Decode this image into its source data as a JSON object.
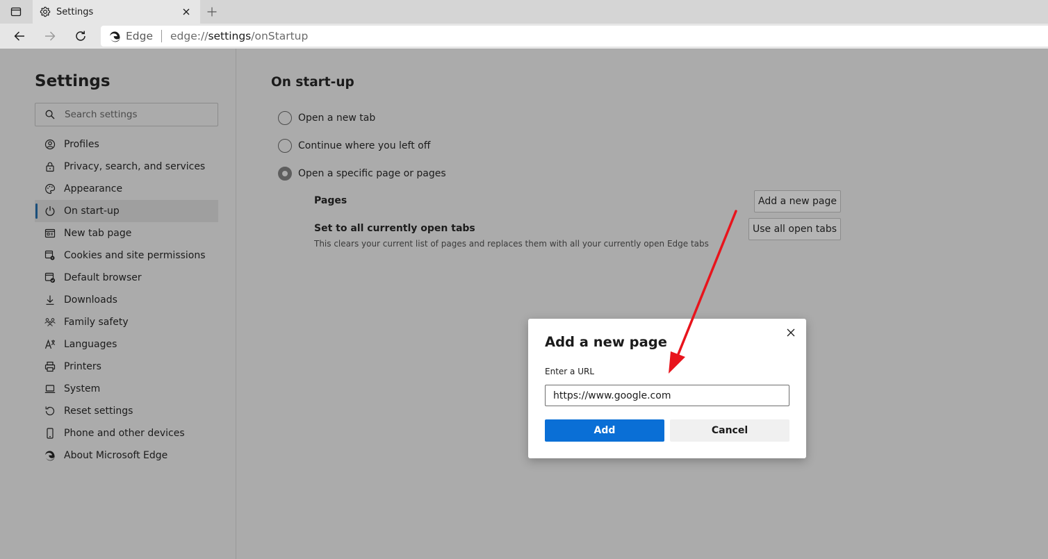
{
  "browser": {
    "tab": {
      "title": "Settings"
    },
    "address": {
      "brand": "Edge",
      "url_prefix": "edge://",
      "url_host": "settings",
      "url_path": "/onStartup"
    }
  },
  "sidebar": {
    "title": "Settings",
    "search_placeholder": "Search settings",
    "items": [
      {
        "label": "Profiles",
        "icon": "profile-icon"
      },
      {
        "label": "Privacy, search, and services",
        "icon": "lock-icon"
      },
      {
        "label": "Appearance",
        "icon": "palette-icon"
      },
      {
        "label": "On start-up",
        "icon": "power-icon",
        "active": true
      },
      {
        "label": "New tab page",
        "icon": "new-tab-icon"
      },
      {
        "label": "Cookies and site permissions",
        "icon": "cookies-icon"
      },
      {
        "label": "Default browser",
        "icon": "default-browser-icon"
      },
      {
        "label": "Downloads",
        "icon": "download-icon"
      },
      {
        "label": "Family safety",
        "icon": "family-icon"
      },
      {
        "label": "Languages",
        "icon": "languages-icon"
      },
      {
        "label": "Printers",
        "icon": "printer-icon"
      },
      {
        "label": "System",
        "icon": "laptop-icon"
      },
      {
        "label": "Reset settings",
        "icon": "reset-icon"
      },
      {
        "label": "Phone and other devices",
        "icon": "phone-icon"
      },
      {
        "label": "About Microsoft Edge",
        "icon": "edge-logo-icon"
      }
    ]
  },
  "main": {
    "heading": "On start-up",
    "options": [
      {
        "label": "Open a new tab",
        "checked": false
      },
      {
        "label": "Continue where you left off",
        "checked": false
      },
      {
        "label": "Open a specific page or pages",
        "checked": true
      }
    ],
    "pages_label": "Pages",
    "add_page_button": "Add a new page",
    "set_tabs_label": "Set to all currently open tabs",
    "set_tabs_desc": "This clears your current list of pages and replaces them with all your currently open Edge tabs",
    "use_tabs_button": "Use all open tabs"
  },
  "dialog": {
    "title": "Add a new page",
    "field_label": "Enter a URL",
    "field_value": "https://www.google.com",
    "add_button": "Add",
    "cancel_button": "Cancel"
  },
  "colors": {
    "accent": "#0a6fd6",
    "overlay_bg": "#ababab",
    "annotation_arrow": "#e8141c"
  }
}
